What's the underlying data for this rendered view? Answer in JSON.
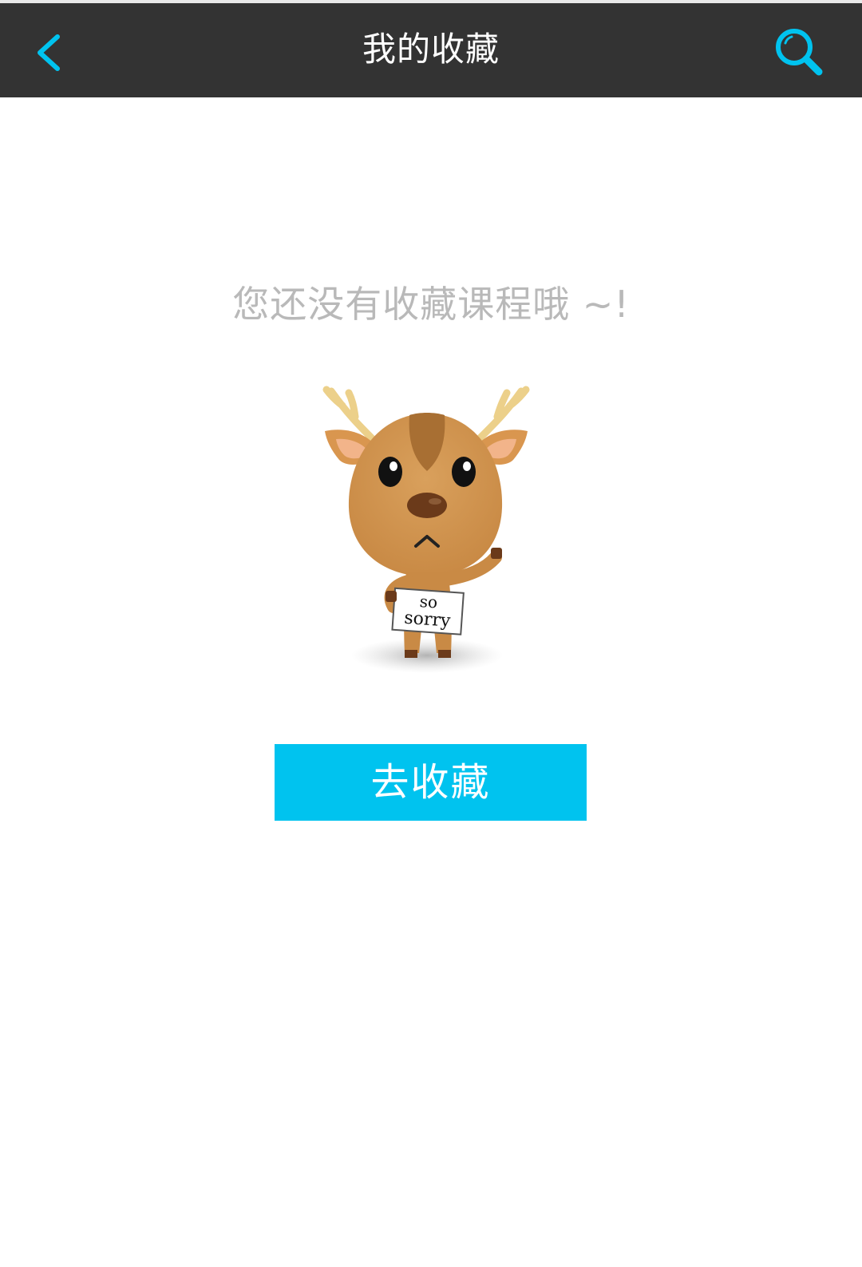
{
  "header": {
    "title": "我的收藏",
    "back_icon": "chevron-left-icon",
    "search_icon": "search-icon"
  },
  "empty_state": {
    "message": "您还没有收藏课程哦 ~!",
    "illustration": "deer-mascot-sorry",
    "sign_text": [
      "so",
      "sorry"
    ]
  },
  "actions": {
    "go_collect_label": "去收藏"
  },
  "colors": {
    "header_bg": "#333333",
    "accent": "#00c3ef",
    "title_text": "#ffffff",
    "message_text": "#b9b9b9"
  }
}
